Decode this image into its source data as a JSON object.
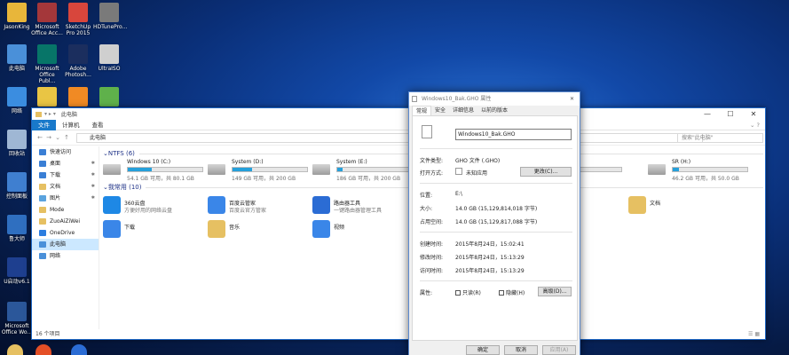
{
  "desktop": {
    "icons": [
      {
        "label": "JasonKing",
        "color": "#e8b63a"
      },
      {
        "label": "Microsoft Office Acc...",
        "color": "#a4373a"
      },
      {
        "label": "SketchUp Pro 2015",
        "color": "#d8463c"
      },
      {
        "label": "HDTunePro...",
        "color": "#7a7a7a"
      },
      {
        "label": "此电脑",
        "color": "#4a90d9"
      },
      {
        "label": "Microsoft Office Publ...",
        "color": "#077568"
      },
      {
        "label": "Adobe Photosh...",
        "color": "#1b2e5e"
      },
      {
        "label": "UltraISO",
        "color": "#cfcfcf"
      },
      {
        "label": "网络",
        "color": "#3b8de0"
      },
      {
        "label": "",
        "color": "#e9c544"
      },
      {
        "label": "",
        "color": "#f08a24"
      },
      {
        "label": "",
        "color": "#5fb14b"
      },
      {
        "label": "回收站",
        "color": "#9fb7d4"
      },
      {
        "label": "控制面板",
        "color": "#3f7fd0"
      },
      {
        "label": "鲁大师",
        "color": "#2f6fc0"
      },
      {
        "label": "U启动v6.1",
        "color": "#1e3f8f"
      },
      {
        "label": "Microsoft Office Wo...",
        "color": "#2b579a"
      }
    ]
  },
  "explorer": {
    "title": "此电脑",
    "window_controls": [
      "—",
      "☐",
      "✕"
    ],
    "ribbon_tabs": [
      "文件",
      "计算机",
      "查看"
    ],
    "address": "此电脑",
    "search_placeholder": "搜索\"此电脑\"",
    "nav": [
      {
        "label": "快速访问",
        "color": "#3a7fd5",
        "pinned": false,
        "selected": false
      },
      {
        "label": "桌面",
        "color": "#3a7fd5",
        "pinned": true,
        "selected": false
      },
      {
        "label": "下载",
        "color": "#3a7fd5",
        "pinned": true,
        "selected": false
      },
      {
        "label": "文档",
        "color": "#e6c062",
        "pinned": true,
        "selected": false
      },
      {
        "label": "图片",
        "color": "#5aa3de",
        "pinned": true,
        "selected": false
      },
      {
        "label": "Mode",
        "color": "#e6c062",
        "pinned": false,
        "selected": false
      },
      {
        "label": "ZuoAiZiWei",
        "color": "#e6c062",
        "pinned": false,
        "selected": false
      },
      {
        "label": "OneDrive",
        "color": "#2a7de0",
        "pinned": false,
        "selected": false
      },
      {
        "label": "此电脑",
        "color": "#4a90d9",
        "pinned": false,
        "selected": true
      },
      {
        "label": "网络",
        "color": "#4a90d9",
        "pinned": false,
        "selected": false
      }
    ],
    "group_ntfs": "NTFS (6)",
    "group_fav": "我常用 (10)",
    "drives": [
      {
        "name": "Windows 10 (C:)",
        "size": "54.1 GB 可用，共 80.1 GB",
        "used": 0.32
      },
      {
        "name": "System (D:)",
        "size": "149 GB 可用，共 200 GB",
        "used": 0.26
      },
      {
        "name": "System (E:)",
        "size": "186 GB 可用，共 200 GB",
        "used": 0.07
      },
      {
        "name": "",
        "size": "",
        "used": 0.3
      },
      {
        "name": "",
        "size": "",
        "used": 0.3
      },
      {
        "name": "SR (H:)",
        "size": "46.2 GB 可用，共 50.0 GB",
        "used": 0.08
      }
    ],
    "favorites": [
      {
        "name": "360云盘",
        "desc": "方便好用的网络云盘",
        "color": "#1e88e5"
      },
      {
        "name": "百度云管家",
        "desc": "百度云官方管家",
        "color": "#3a86e8"
      },
      {
        "name": "路由器工具",
        "desc": "一键路由器管理工具",
        "color": "#2b6cd4"
      },
      {
        "name": "文档",
        "desc": "",
        "color": "#e6c062"
      },
      {
        "name": "下载",
        "desc": "",
        "color": "#3a86e8"
      },
      {
        "name": "音乐",
        "desc": "",
        "color": "#e6c062"
      },
      {
        "name": "视频",
        "desc": "",
        "color": "#3a86e8"
      }
    ],
    "status": "16 个项目"
  },
  "dialog": {
    "title": "Windows10_Bak.GHO 属性",
    "close": "✕",
    "tabs": [
      "常规",
      "安全",
      "详细信息",
      "以前的版本"
    ],
    "filename": "Windows10_Bak.GHO",
    "type_label": "文件类型:",
    "type_value": "GHO 文件 (.GHO)",
    "open_label": "打开方式:",
    "open_value": "未知应用",
    "change_btn": "更改(C)...",
    "location_label": "位置:",
    "location_value": "E:\\",
    "size_label": "大小:",
    "size_value": "14.0 GB (15,129,814,018 字节)",
    "disksize_label": "占用空间:",
    "disksize_value": "14.0 GB (15,129,817,088 字节)",
    "created_label": "创建时间:",
    "created_value": "2015年8月24日，15:02:41",
    "modified_label": "修改时间:",
    "modified_value": "2015年8月24日，15:13:29",
    "accessed_label": "访问时间:",
    "accessed_value": "2015年8月24日，15:13:29",
    "attr_label": "属性:",
    "readonly_label": "只读(R)",
    "hidden_label": "隐藏(H)",
    "advanced_btn": "高级(D)...",
    "ok": "确定",
    "cancel": "取消",
    "apply": "应用(A)"
  }
}
